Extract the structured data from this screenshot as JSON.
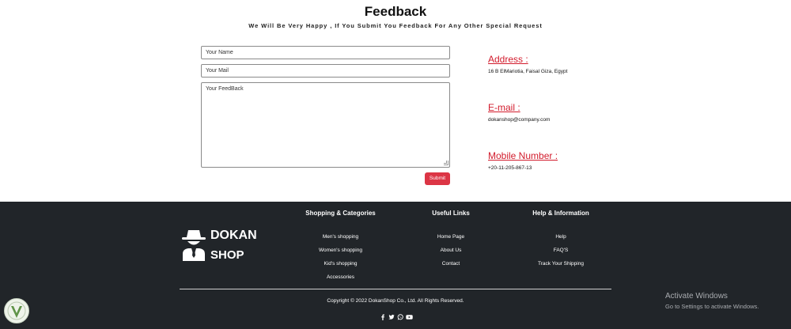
{
  "feedback": {
    "title": "Feedback",
    "subtitle": "We Will Be Very Happy , If You Submit You Feedback For Any Other Special Request",
    "name_placeholder": "Your Name",
    "mail_placeholder": "Your Mail",
    "message_placeholder": "Your FeedBack",
    "submit_label": "Submit"
  },
  "contact": {
    "address_heading": "Address :",
    "address_value": "16 B ElMariotia, Faisal Giza, Egypt",
    "email_heading": "E-mail :",
    "email_value": "dokanshop@company.com",
    "mobile_heading": "Mobile Number :",
    "mobile_value": "+20-11-205-867-13"
  },
  "footer": {
    "logo_line1": "DOKAN",
    "logo_line2": "SHOP",
    "columns": [
      {
        "heading": "Shopping & Categories",
        "links": [
          "Men's shopping",
          "Women's shopping",
          "Kid's shopping",
          "Accessories"
        ]
      },
      {
        "heading": "Useful Links",
        "links": [
          "Home Page",
          "About Us",
          "Contact"
        ]
      },
      {
        "heading": "Help & Information",
        "links": [
          "Help",
          "FAQ'S",
          "Track Your Shipping"
        ]
      }
    ],
    "copyright": "Copyright © 2022 DokanShop Co., Ltd. All Rights Reserved.",
    "social_icons": [
      "facebook-icon",
      "twitter-icon",
      "whatsapp-icon",
      "youtube-icon"
    ]
  },
  "watermark": {
    "line1": "Activate Windows",
    "line2": "Go to Settings to activate Windows."
  },
  "colors": {
    "accent_red": "#dc3545",
    "heading_red": "#d21b2c",
    "footer_bg": "#212529"
  }
}
